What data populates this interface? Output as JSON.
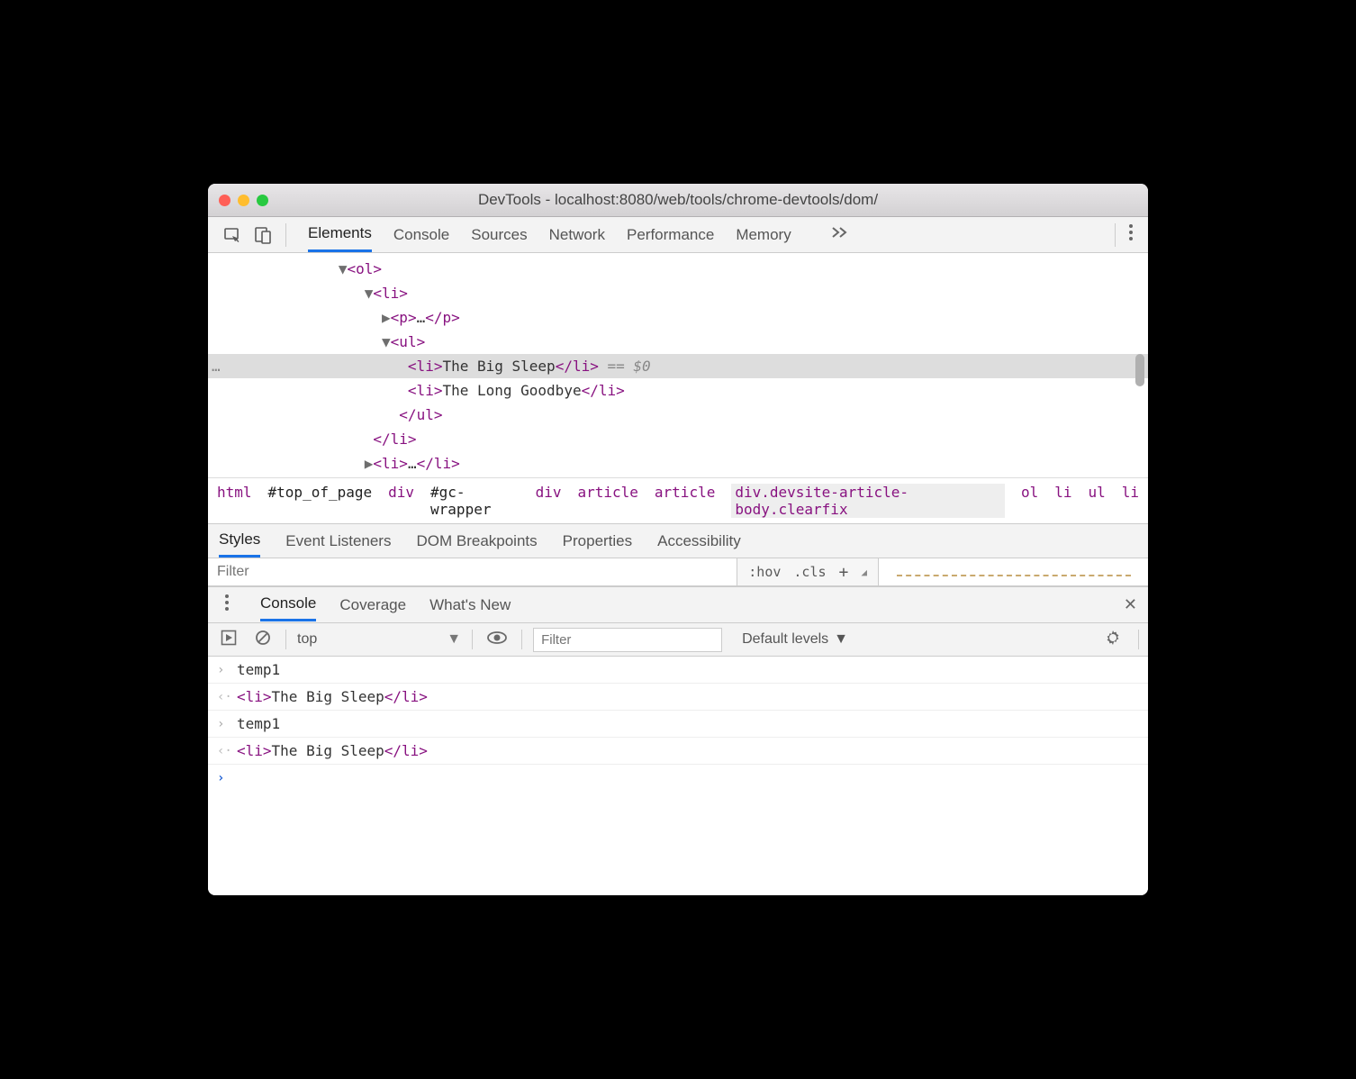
{
  "titlebar": {
    "title": "DevTools - localhost:8080/web/tools/chrome-devtools/dom/"
  },
  "tabs": [
    "Elements",
    "Console",
    "Sources",
    "Network",
    "Performance",
    "Memory"
  ],
  "active_tab": "Elements",
  "dom": {
    "lines": [
      {
        "indent": 150,
        "tri": "▼",
        "open": "ol"
      },
      {
        "indent": 175,
        "tri": "▼",
        "open": "li"
      },
      {
        "indent": 200,
        "tri": "▶",
        "open": "p",
        "ellipsis": true,
        "close": "p"
      },
      {
        "indent": 200,
        "tri": "▼",
        "open": "ul"
      },
      {
        "indent": 230,
        "open": "li",
        "text": "The Big Sleep",
        "close": "li",
        "eqs": " == $0",
        "selected": true
      },
      {
        "indent": 230,
        "open": "li",
        "text": "The Long Goodbye",
        "close": "li"
      },
      {
        "indent": 215,
        "closeOnly": "ul"
      },
      {
        "indent": 190,
        "closeOnly": "li"
      },
      {
        "indent": 175,
        "tri": "▶",
        "open": "li",
        "ellipsis": true,
        "close": "li"
      }
    ],
    "gutter_dots": "…"
  },
  "breadcrumb": [
    {
      "t": "html"
    },
    {
      "t": "#top_of_page",
      "cls": "bc-id"
    },
    {
      "t": "div"
    },
    {
      "t": "#gc-wrapper",
      "cls": "bc-id"
    },
    {
      "t": "div"
    },
    {
      "t": "article"
    },
    {
      "t": "article"
    },
    {
      "t": "div.devsite-article-body.clearfix",
      "cls": "bc-sel"
    },
    {
      "t": "ol"
    },
    {
      "t": "li"
    },
    {
      "t": "ul"
    },
    {
      "t": "li"
    }
  ],
  "subtabs": [
    "Styles",
    "Event Listeners",
    "DOM Breakpoints",
    "Properties",
    "Accessibility"
  ],
  "active_subtab": "Styles",
  "filter": {
    "placeholder": "Filter",
    "hov": ":hov",
    "cls": ".cls"
  },
  "drawer_tabs": [
    "Console",
    "Coverage",
    "What's New"
  ],
  "active_drawer_tab": "Console",
  "console_toolbar": {
    "context": "top",
    "filter_placeholder": "Filter",
    "levels": "Default levels"
  },
  "console": [
    {
      "dir": "in",
      "text": "temp1"
    },
    {
      "dir": "out",
      "tag": "li",
      "content": "The Big Sleep"
    },
    {
      "dir": "in",
      "text": "temp1"
    },
    {
      "dir": "out",
      "tag": "li",
      "content": "The Big Sleep"
    }
  ]
}
